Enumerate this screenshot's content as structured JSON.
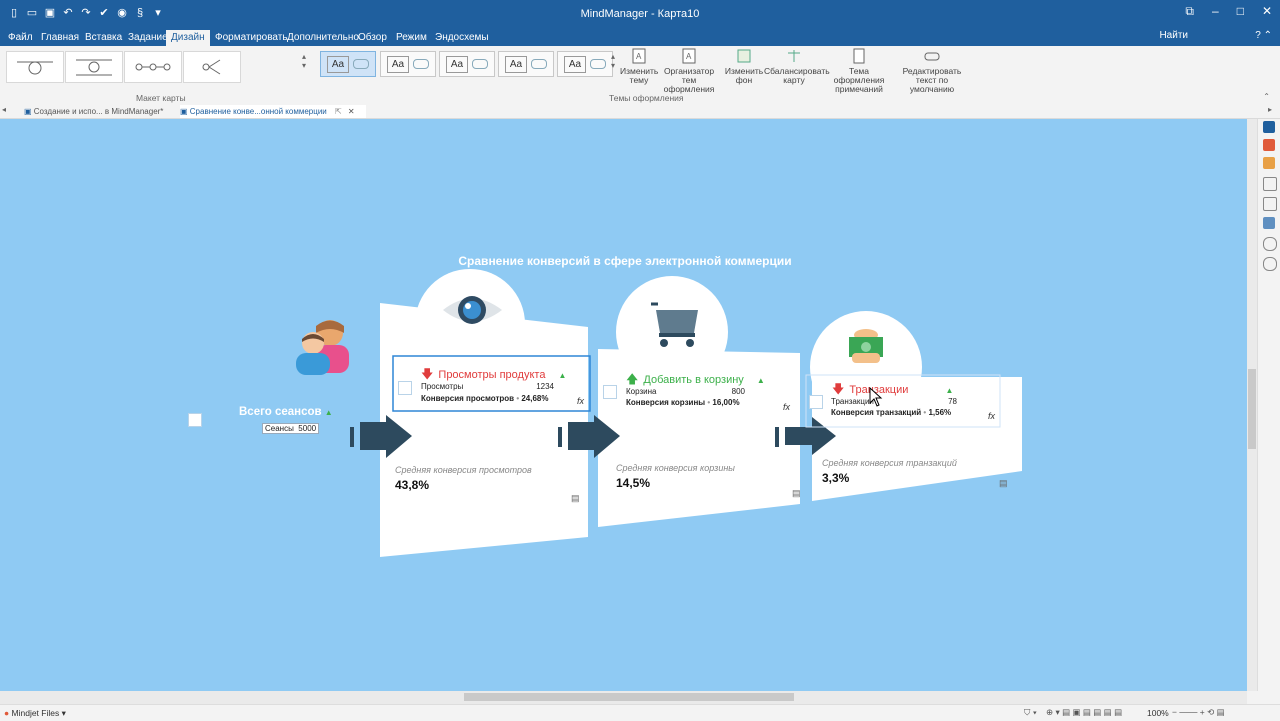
{
  "window": {
    "title": "MindManager - Карта10",
    "controls": [
      "restore",
      "minimize",
      "maximize",
      "close"
    ]
  },
  "ribbon_tabs": [
    {
      "label": "Файл",
      "active": false
    },
    {
      "label": "Главная",
      "active": false
    },
    {
      "label": "Вставка",
      "active": false
    },
    {
      "label": "Задание",
      "active": false
    },
    {
      "label": "Дизайн",
      "active": true
    },
    {
      "label": "Форматировать",
      "active": false
    },
    {
      "label": "Дополнительно",
      "active": false
    },
    {
      "label": "Обзор",
      "active": false
    },
    {
      "label": "Режим",
      "active": false
    },
    {
      "label": "Эндосхемы",
      "active": false
    }
  ],
  "find_label": "Найти",
  "ribbon": {
    "layout_group_label": "Макет карты",
    "themes_group_label": "Темы оформления",
    "theme_sample_text": "Aa",
    "buttons": [
      {
        "label": "Изменить тему"
      },
      {
        "label": "Организатор тем оформления"
      },
      {
        "label": "Изменить фон"
      },
      {
        "label": "Сбалансировать карту"
      },
      {
        "label": "Тема оформления примечаний"
      },
      {
        "label": "Редактировать текст по умолчанию"
      }
    ]
  },
  "doc_tabs": [
    {
      "label": "Создание и испо... в MindManager*",
      "active": false
    },
    {
      "label": "Сравнение конве...онной коммерции",
      "active": true
    }
  ],
  "map": {
    "title": "Сравнение конверсий в сфере электронной коммерции",
    "central": {
      "label": "Всего сеансов",
      "field_label": "Сеансы",
      "field_value": "5000"
    },
    "stages": [
      {
        "title": "Просмотры продукта",
        "trend": "down",
        "row1_label": "Просмотры",
        "row1_value": "1234",
        "row2_label": "Конверсия просмотров",
        "row2_value": "24,68%",
        "avg_label": "Средняя конверсия просмотров",
        "avg_value": "43,8%",
        "icon": "eye-icon"
      },
      {
        "title": "Добавить в корзину",
        "trend": "up",
        "row1_label": "Корзина",
        "row1_value": "800",
        "row2_label": "Конверсия корзины",
        "row2_value": "16,00%",
        "avg_label": "Средняя конверсия корзины",
        "avg_value": "14,5%",
        "icon": "cart-icon"
      },
      {
        "title": "Транзакции",
        "trend": "down",
        "row1_label": "Транзакции",
        "row1_value": "78",
        "row2_label": "Конверсия транзакций",
        "row2_value": "1,56%",
        "avg_label": "Средняя конверсия транзакций",
        "avg_value": "3,3%",
        "icon": "money-icon"
      }
    ],
    "formula_glyph": "fx"
  },
  "status": {
    "files_label": "Mindjet Files",
    "zoom": "100%"
  },
  "colors": {
    "title_bar": "#1f5f9e",
    "canvas": "#8fcaf3",
    "panel": "#ffffff",
    "arrow": "#2d4a5e",
    "down": "#e03c3c",
    "up": "#3cb04a"
  }
}
